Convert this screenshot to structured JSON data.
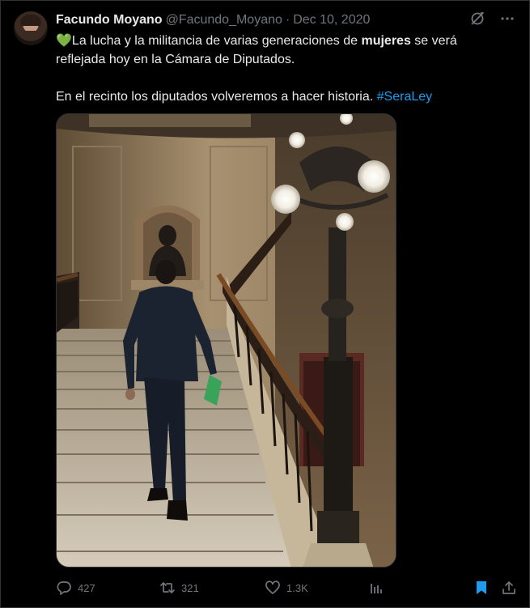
{
  "tweet": {
    "author_name": "Facundo Moyano",
    "handle": "@Facundo_Moyano",
    "separator": "·",
    "date": "Dec 10, 2020",
    "text_part1": "La lucha y la militancia de varias generaciones de ",
    "text_bold": "mujeres",
    "text_part2": " se verá reflejada hoy en la Cámara de Diputados.",
    "text_line2": "En el recinto los diputados volveremos a hacer historia. ",
    "hashtag": "#SeraLey",
    "emoji": "💚"
  },
  "actions": {
    "replies": "427",
    "retweets": "321",
    "likes": "1.3K"
  },
  "icons": {
    "top": [
      "grok-icon",
      "more-icon"
    ],
    "actions": [
      "reply-icon",
      "retweet-icon",
      "like-icon",
      "views-icon",
      "bookmark-icon",
      "share-icon"
    ]
  },
  "colors": {
    "background": "#000000",
    "text": "#e7e9ea",
    "muted": "#71767b",
    "accent": "#1d9bf0",
    "heart": "#78b159"
  }
}
